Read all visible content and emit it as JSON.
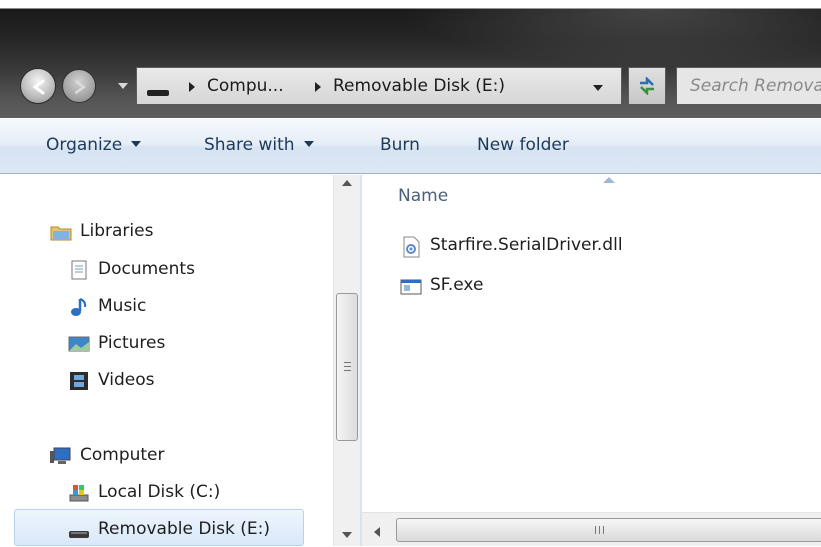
{
  "address_bar": {
    "breadcrumbs": [
      "Compu...",
      "Removable Disk (E:)"
    ],
    "search_placeholder": "Search Removable Disk (E:)"
  },
  "toolbar": {
    "organize_label": "Organize",
    "share_with_label": "Share with",
    "burn_label": "Burn",
    "new_folder_label": "New folder"
  },
  "nav_pane": {
    "libraries": {
      "label": "Libraries",
      "icon": "libraries-icon"
    },
    "library_items": [
      {
        "label": "Documents",
        "icon": "documents-icon"
      },
      {
        "label": "Music",
        "icon": "music-icon"
      },
      {
        "label": "Pictures",
        "icon": "pictures-icon"
      },
      {
        "label": "Videos",
        "icon": "videos-icon"
      }
    ],
    "computer": {
      "label": "Computer",
      "icon": "computer-icon"
    },
    "computer_items": [
      {
        "label": "Local Disk (C:)",
        "icon": "local-disk-icon"
      },
      {
        "label": "Removable Disk (E:)",
        "icon": "removable-disk-icon",
        "selected": true
      }
    ]
  },
  "content": {
    "columns": [
      "Name"
    ],
    "files": [
      {
        "name": "Starfire.SerialDriver.dll",
        "icon": "dll-file-icon"
      },
      {
        "name": "SF.exe",
        "icon": "exe-file-icon"
      }
    ]
  },
  "colors": {
    "command_text": "#1e395b",
    "selection_bg": "#d9e8f9",
    "title_dark": "#262626"
  }
}
